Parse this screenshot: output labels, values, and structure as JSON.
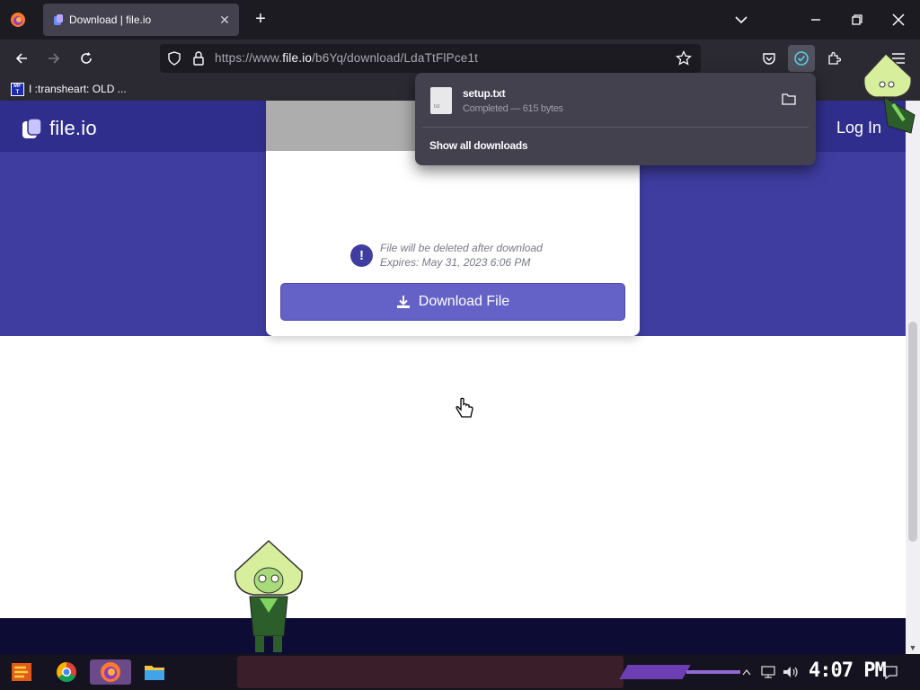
{
  "browser": {
    "tab": {
      "title": "Download | file.io",
      "close": "✕"
    },
    "new_tab": "+",
    "url": {
      "prefix": "https://www.",
      "domain": "file.io",
      "path": "/b6Yq/download/LdaTtFlPce1t"
    },
    "bookmark": {
      "icon_text": "MF\nT",
      "label": "I :transheart: OLD ..."
    }
  },
  "page": {
    "logo_text": "file.io",
    "login_label": "Log In",
    "notice_icon": "!",
    "notice_line1": "File will be deleted after download",
    "notice_line2": "Expires: May 31, 2023 6:06 PM",
    "download_button": "Download File"
  },
  "downloads_panel": {
    "file_name": "setup.txt",
    "status": "Completed — 615 bytes",
    "show_all": "Show all downloads"
  },
  "taskbar": {
    "clock": "4:07 PM"
  },
  "colors": {
    "hero": "#3f3da0",
    "header": "#302e8c",
    "button": "#6461c7",
    "footer": "#0c0c35"
  }
}
